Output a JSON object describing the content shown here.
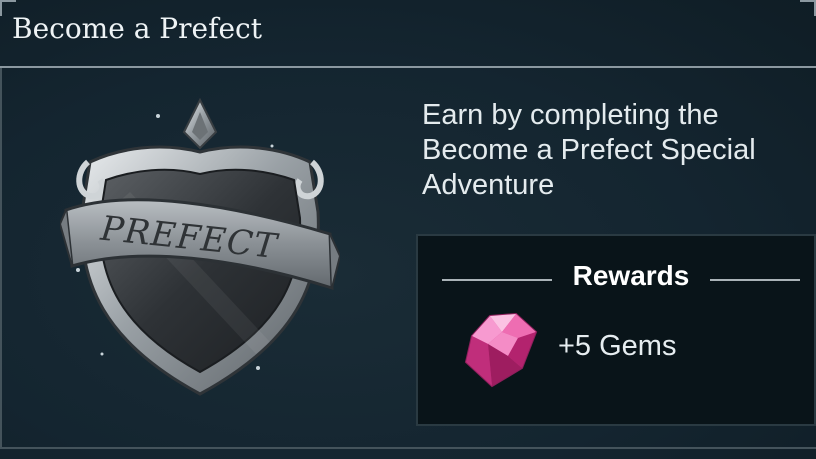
{
  "header": {
    "title": "Become a Prefect"
  },
  "badge": {
    "icon": "prefect-badge-icon",
    "banner_text": "PREFECT"
  },
  "description": "Earn by completing the Become a Prefect Special Adventure",
  "rewards": {
    "title": "Rewards",
    "items": [
      {
        "icon": "pink-gem-icon",
        "label": "+5 Gems"
      }
    ]
  },
  "colors": {
    "background": "#13222b",
    "panel": "#091419",
    "gem": "#e0449a",
    "text": "#e4ebee"
  }
}
